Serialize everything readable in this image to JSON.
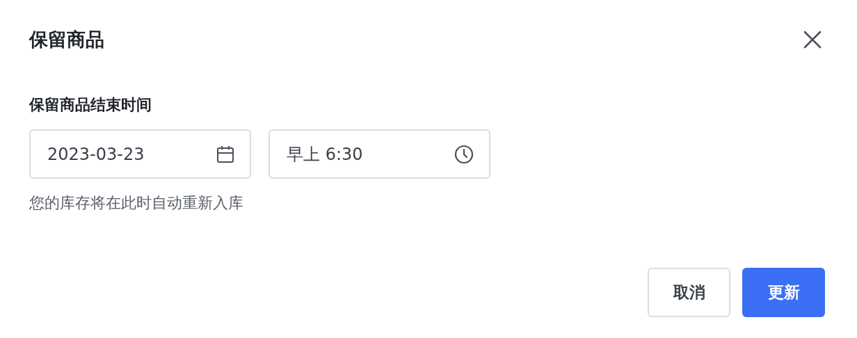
{
  "dialog": {
    "title": "保留商品"
  },
  "field_label": "保留商品结束时间",
  "date": {
    "value": "2023-03-23"
  },
  "time": {
    "value": "早上 6:30"
  },
  "helper": "您的库存将在此时自动重新入库",
  "buttons": [
    {
      "label": "取消",
      "kind": "secondary"
    },
    {
      "label": "更新",
      "kind": "primary"
    }
  ]
}
